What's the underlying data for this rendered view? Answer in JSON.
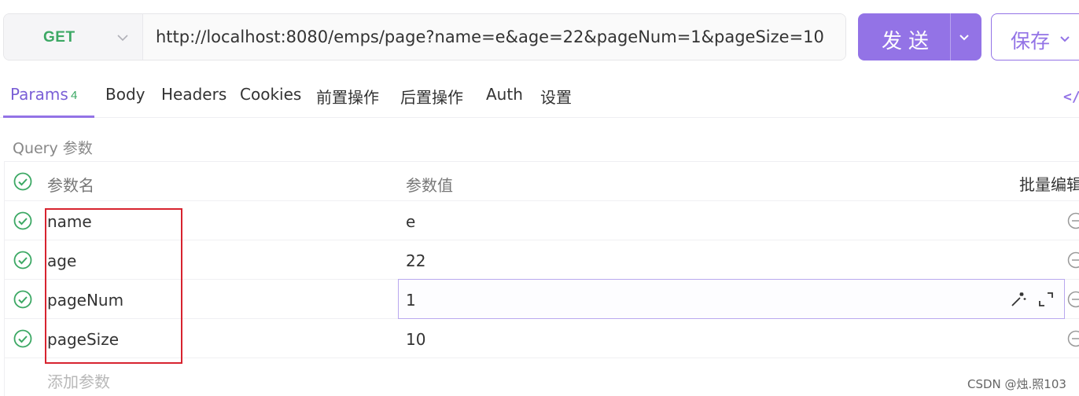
{
  "request": {
    "method": "GET",
    "url": "http://localhost:8080/emps/page?name=e&age=22&pageNum=1&pageSize=10",
    "send_label": "发送",
    "save_label": "保存"
  },
  "tabs": [
    {
      "label": "Params",
      "count": "4"
    },
    {
      "label": "Body"
    },
    {
      "label": "Headers"
    },
    {
      "label": "Cookies"
    },
    {
      "label": "前置操作"
    },
    {
      "label": "后置操作"
    },
    {
      "label": "Auth"
    },
    {
      "label": "设置"
    }
  ],
  "code_icon_label": "</>",
  "query": {
    "section_title": "Query 参数",
    "header": {
      "name": "参数名",
      "value": "参数值",
      "bulk_edit": "批量编辑"
    },
    "params": [
      {
        "name": "name",
        "value": "e"
      },
      {
        "name": "age",
        "value": "22"
      },
      {
        "name": "pageNum",
        "value": "1"
      },
      {
        "name": "pageSize",
        "value": "10"
      }
    ],
    "add_placeholder": "添加参数"
  },
  "watermark": "CSDN @烛.照103",
  "colors": {
    "accent": "#9373e6",
    "method_get": "#3ca864",
    "check": "#3ca864",
    "annotation": "#d7232f"
  }
}
